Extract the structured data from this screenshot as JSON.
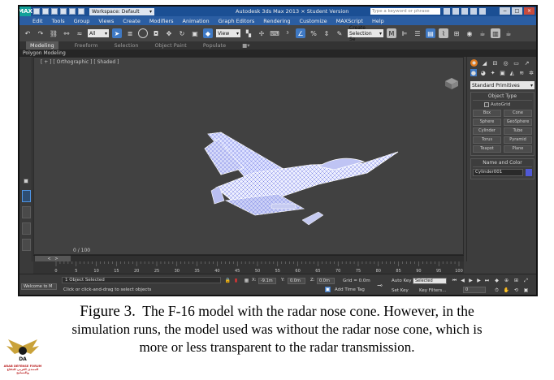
{
  "titlebar": {
    "app_logo": "MAX",
    "workspace": "Workspace: Default",
    "title": "Autodesk 3ds Max 2013 × Student Version",
    "search_placeholder": "Type a keyword or phrase",
    "window_buttons": [
      "−",
      "□",
      "×"
    ]
  },
  "menu": [
    "Edit",
    "Tools",
    "Group",
    "Views",
    "Create",
    "Modifiers",
    "Animation",
    "Graph Editors",
    "Rendering",
    "Customize",
    "MAXScript",
    "Help"
  ],
  "toolbar": {
    "selection_filter": "All",
    "reference_coord": "View",
    "named_selection": "Create Selection Se"
  },
  "ribbon": {
    "tabs": [
      "Modeling",
      "Freeform",
      "Selection",
      "Object Paint",
      "Populate"
    ],
    "active_tab": "Modeling",
    "panel_label": "Polygon Modeling"
  },
  "viewport": {
    "label": "[ + ] [ Orthographic ] [ Shaded ]",
    "frame_readout": "0 / 100"
  },
  "command_panel": {
    "category": "Standard Primitives",
    "object_type_header": "Object Type",
    "autogrid_label": "AutoGrid",
    "object_types": [
      "Box",
      "Cone",
      "Sphere",
      "GeoSphere",
      "Cylinder",
      "Tube",
      "Torus",
      "Pyramid",
      "Teapot",
      "Plane"
    ],
    "name_color_header": "Name and Color",
    "object_name": "Cylinder001",
    "object_color": "#5059d6"
  },
  "timeline": {
    "ticks": [
      "0",
      "5",
      "10",
      "15",
      "20",
      "25",
      "30",
      "35",
      "40",
      "45",
      "50",
      "55",
      "60",
      "65",
      "70",
      "75",
      "80",
      "85",
      "90",
      "95",
      "100"
    ]
  },
  "statusbar": {
    "maxscript_label": "Welcome to M",
    "selection_status": "1 Object Selected",
    "prompt": "Click or click-and-drag to select objects",
    "x_value": "-9.1m",
    "y_value": "0.0m",
    "z_value": "0.0m",
    "grid": "Grid = 0.0m",
    "add_time_tag": "Add Time Tag",
    "auto_key": "Auto Key",
    "auto_key_mode": "Selected",
    "set_key": "Set Key",
    "key_filters": "Key Filters...",
    "current_frame": "0"
  },
  "caption": {
    "figure_label": "Figure 3.",
    "line1_text": "The F-16 model with the radar nose cone. However, in the",
    "line2": "simulation runs, the model used was without the radar nose cone, which is",
    "line3": "more or less transparent to the radar transmission."
  },
  "logo": {
    "abbr": "DA",
    "text_en": "ARAB DEFENSE FORUM",
    "text_ar": "المنتدى العربي للدفاع والتسليح"
  },
  "colors": {
    "title_bar": "#1b4f94",
    "menu_bar": "#2b5ea3",
    "viewport_bg": "#414141",
    "accent_blue": "#3f79c4",
    "accent_orange": "#e07b1f"
  }
}
